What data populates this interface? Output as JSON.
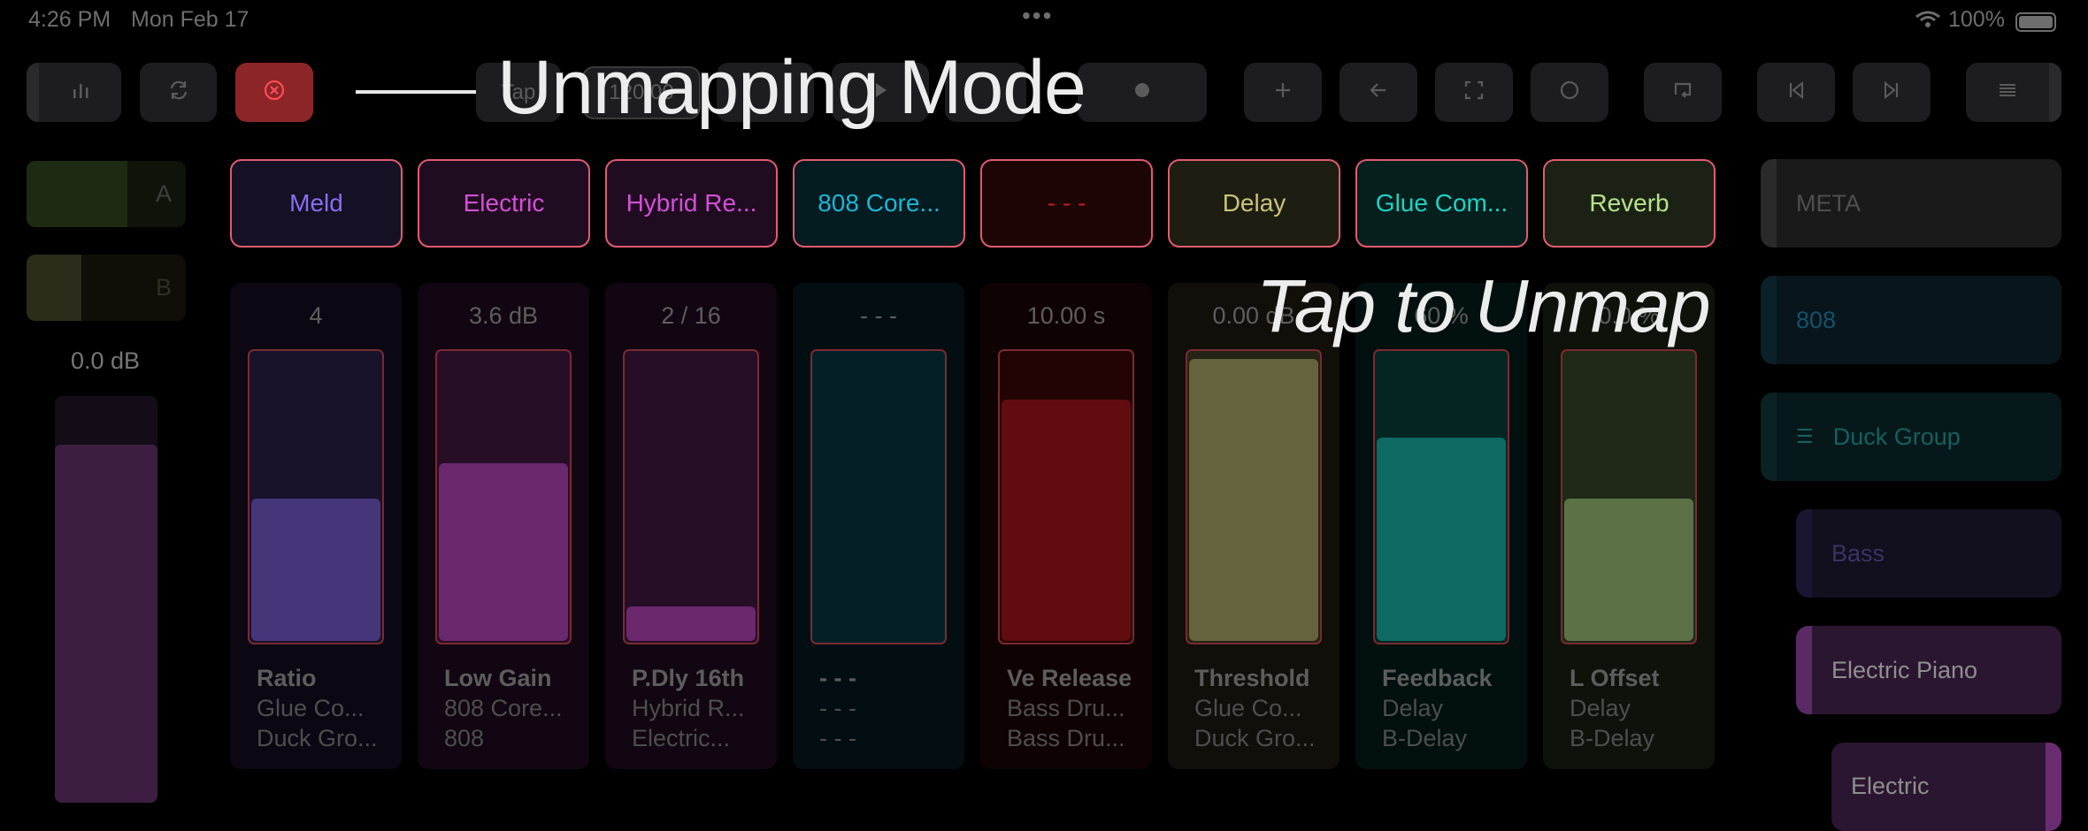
{
  "status": {
    "time": "4:26 PM",
    "date": "Mon Feb 17",
    "battery": "100%",
    "dots": "•••"
  },
  "overlay": {
    "title": "Unmapping Mode",
    "subtitle": "Tap to Unmap"
  },
  "toolbar": {
    "tap_label": "Tap",
    "tempo": "120.00",
    "buttons": [
      "levels-icon",
      "sync-icon",
      "close-circle-icon",
      "play-icon",
      "record-icon",
      "plus-icon",
      "back-arrow-icon",
      "expand-icon",
      "circle-icon",
      "loop-icon",
      "skip-back-icon",
      "skip-forward-icon",
      "menu-icon"
    ]
  },
  "left": {
    "track_a": "A",
    "track_b": "B",
    "gain": "0.0 dB",
    "level_fraction": 0.88
  },
  "devices": [
    {
      "label": "Meld",
      "color": "#8b6cf0"
    },
    {
      "label": "Electric",
      "color": "#d44fd8"
    },
    {
      "label": "Hybrid Re...",
      "color": "#d44fd8"
    },
    {
      "label": "808 Core...",
      "color": "#1ab7d6"
    },
    {
      "label": "- - -",
      "color": "#c0181f"
    },
    {
      "label": "Delay",
      "color": "#c9c47a"
    },
    {
      "label": "Glue Com...",
      "color": "#1fd2c3"
    },
    {
      "label": "Reverb",
      "color": "#b7e28b"
    }
  ],
  "strips": [
    {
      "value": "4",
      "param": "Ratio",
      "device": "Glue Co...",
      "track": "Duck Gro...",
      "level": 0.5
    },
    {
      "value": "3.6 dB",
      "param": "Low Gain",
      "device": "808 Core...",
      "track": "808",
      "level": 0.62
    },
    {
      "value": "2  / 16",
      "param": "P.Dly 16th",
      "device": "Hybrid R...",
      "track": "Electric...",
      "level": 0.13
    },
    {
      "value": "- - -",
      "param": "- - -",
      "device": "- - -",
      "track": "- - -",
      "level": 0
    },
    {
      "value": "10.00 s",
      "param": "Ve Release",
      "device": "Bass Dru...",
      "track": "Bass Dru...",
      "level": 0.84
    },
    {
      "value": "0.00 dB",
      "param": "Threshold",
      "device": "Glue Co...",
      "track": "Duck Gro...",
      "level": 0.98
    },
    {
      "value": "60 %",
      "param": "Feedback",
      "device": "Delay",
      "track": "B-Delay",
      "level": 0.71
    },
    {
      "value": "0.0 %",
      "param": "L Offset",
      "device": "Delay",
      "track": "B-Delay",
      "level": 0.5
    }
  ],
  "right": {
    "meta": "META",
    "t808": "808",
    "duck": "Duck Group",
    "bass": "Bass",
    "epiano": "Electric Piano",
    "electric": "Electric"
  }
}
